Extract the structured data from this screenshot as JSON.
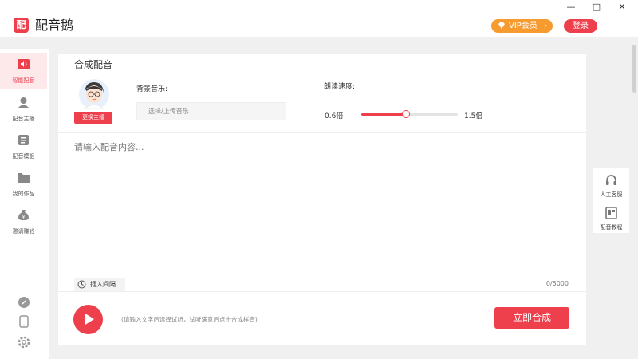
{
  "app": {
    "logo_char": "配",
    "name": "配音鹅"
  },
  "header": {
    "vip_label": "VIP会员",
    "vip_chevron": "›",
    "login_label": "登录"
  },
  "window_controls": {
    "minimize": "—",
    "maximize": "□",
    "close": "✕"
  },
  "sidebar": {
    "items": [
      {
        "label": "智能配音",
        "icon": "speaker-icon",
        "active": true
      },
      {
        "label": "配音主播",
        "icon": "person-icon",
        "active": false
      },
      {
        "label": "配音模板",
        "icon": "template-icon",
        "active": false
      },
      {
        "label": "我的作品",
        "icon": "folder-icon",
        "active": false
      },
      {
        "label": "邀请赚钱",
        "icon": "money-bag-icon",
        "active": false
      }
    ],
    "bottom_icons": [
      "link-icon",
      "phone-icon",
      "settings-icon"
    ]
  },
  "main": {
    "title": "合成配音",
    "change_anchor_label": "更换主播",
    "bgm_label": "背景音乐:",
    "bgm_placeholder": "选择/上传音乐",
    "speed_label": "朗读速度:",
    "speed_min": "0.6倍",
    "speed_max": "1.5倍",
    "speed_value_fraction": 0.46,
    "text_placeholder": "请输入配音内容...",
    "insert_pause_label": "插入间隔",
    "char_count": "0/5000",
    "hint": "(请输入文字后选择试听，试听满意后点击合成样音)",
    "synth_label": "立即合成"
  },
  "float_panel": {
    "items": [
      {
        "label": "人工客服",
        "icon": "headset-icon"
      },
      {
        "label": "配音教程",
        "icon": "book-icon"
      }
    ]
  },
  "colors": {
    "accent": "#ee3f4d",
    "vip": "#f79a2f"
  }
}
